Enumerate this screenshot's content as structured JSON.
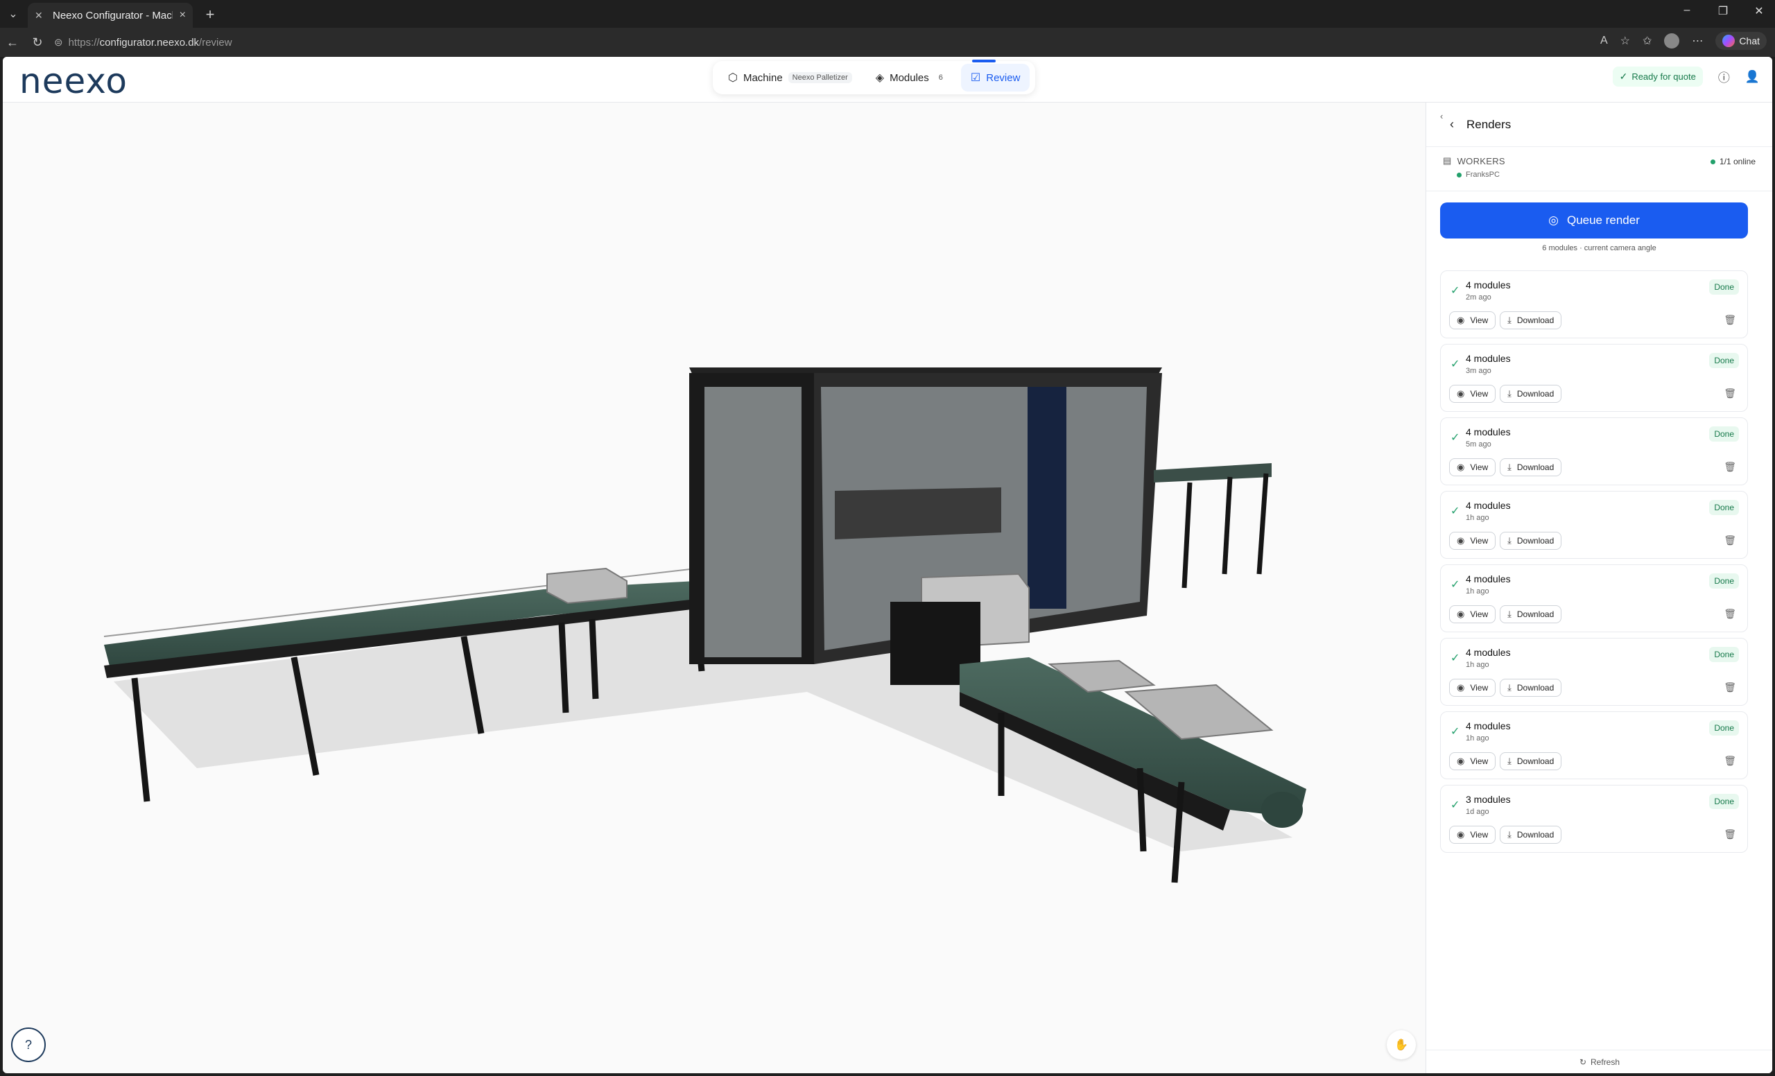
{
  "browser": {
    "tab_title": "Neexo Configurator - Machine Co",
    "url_prefix": "https://",
    "url_host": "configurator.neexo.dk",
    "url_path": "/review",
    "chat_label": "Chat"
  },
  "app": {
    "logo_text": "neexo",
    "steps": [
      {
        "label": "Machine",
        "sub": "Neexo Palletizer",
        "icon": "cube-icon"
      },
      {
        "label": "Modules",
        "sub": "6",
        "icon": "layers-icon"
      },
      {
        "label": "Review",
        "sub": "",
        "icon": "clipboard-check-icon"
      }
    ],
    "ready_label": "Ready for quote"
  },
  "panel": {
    "title": "Renders",
    "workers_label": "WORKERS",
    "worker_name": "FranksPC",
    "online_label": "1/1 online",
    "queue_label": "Queue render",
    "queue_sub": "6 modules · current camera angle",
    "view_label": "View",
    "download_label": "Download",
    "done_label": "Done",
    "renders": [
      {
        "name": "4 modules",
        "time": "2m ago"
      },
      {
        "name": "4 modules",
        "time": "3m ago"
      },
      {
        "name": "4 modules",
        "time": "5m ago"
      },
      {
        "name": "4 modules",
        "time": "1h ago"
      },
      {
        "name": "4 modules",
        "time": "1h ago"
      },
      {
        "name": "4 modules",
        "time": "1h ago"
      },
      {
        "name": "4 modules",
        "time": "1h ago"
      },
      {
        "name": "3 modules",
        "time": "1d ago"
      }
    ],
    "refresh_label": "Refresh"
  },
  "colors": {
    "accent": "#1a5cf0",
    "success": "#22a06b",
    "logo": "#1d3a5c"
  }
}
